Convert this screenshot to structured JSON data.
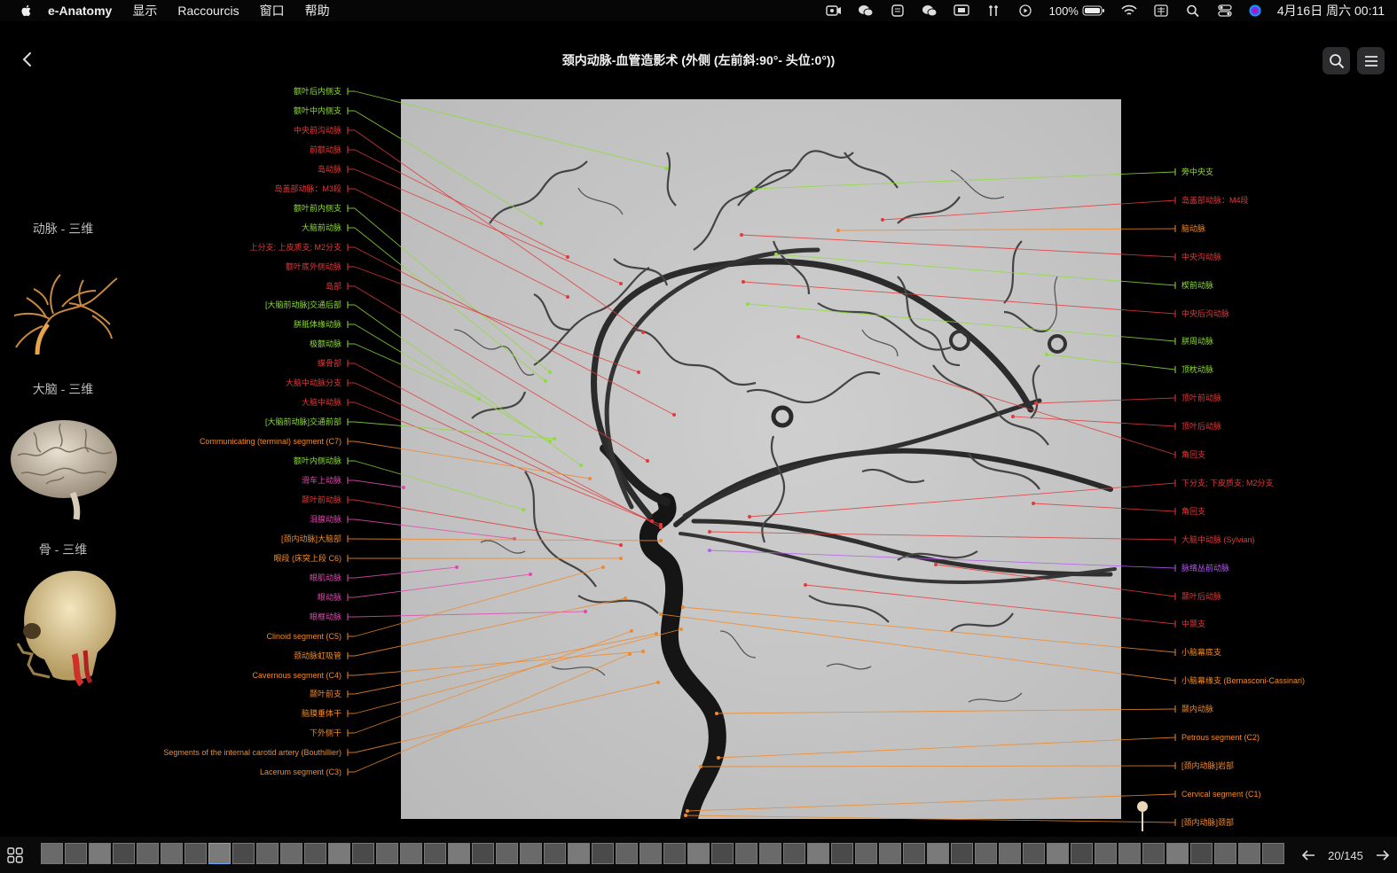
{
  "menubar": {
    "app_name": "e-Anatomy",
    "items": [
      "显示",
      "Raccourcis",
      "窗口",
      "帮助"
    ],
    "battery": "100%",
    "datetime": "4月16日 周六 00:11"
  },
  "header": {
    "title": "颈内动脉-血管造影术 (外侧 (左前斜:90°- 头位:0°))"
  },
  "sidebar": {
    "items": [
      {
        "label": "动脉 - 三维"
      },
      {
        "label": "大脑 - 三维"
      },
      {
        "label": "骨 - 三维"
      }
    ]
  },
  "labels_left": [
    {
      "text": "额叶后内侧支",
      "color": "#8fdc3a"
    },
    {
      "text": "额叶中内侧支",
      "color": "#8fdc3a"
    },
    {
      "text": "中央前沟动脉",
      "color": "#e23a3a"
    },
    {
      "text": "前额动脉",
      "color": "#e23a3a"
    },
    {
      "text": "岛动脉",
      "color": "#e23a3a"
    },
    {
      "text": "岛盖部动脉：M3段",
      "color": "#e23a3a"
    },
    {
      "text": "额叶前内侧支",
      "color": "#8fdc3a"
    },
    {
      "text": "大脑前动脉",
      "color": "#8fdc3a"
    },
    {
      "text": "上分支; 上皮质支; M2分支",
      "color": "#e23a3a"
    },
    {
      "text": "额叶底外侧动脉",
      "color": "#e23a3a"
    },
    {
      "text": "岛部",
      "color": "#e23a3a"
    },
    {
      "text": "[大脑前动脉]交通后部",
      "color": "#8fdc3a"
    },
    {
      "text": "胼胝体缘动脉",
      "color": "#8fdc3a"
    },
    {
      "text": "极额动脉",
      "color": "#8fdc3a"
    },
    {
      "text": "蝶骨部",
      "color": "#e23a3a"
    },
    {
      "text": "大脑中动脉分支",
      "color": "#e23a3a"
    },
    {
      "text": "大脑中动脉",
      "color": "#e23a3a"
    },
    {
      "text": "[大脑前动脉]交通前部",
      "color": "#8fdc3a"
    },
    {
      "text": "Communicating (terminal) segment (C7)",
      "color": "#f08a2a"
    },
    {
      "text": "额叶内侧动脉",
      "color": "#8fdc3a"
    },
    {
      "text": "滑车上动脉",
      "color": "#e04ab0"
    },
    {
      "text": "颞叶前动脉",
      "color": "#e23a3a"
    },
    {
      "text": "泪腺动脉",
      "color": "#e04ab0"
    },
    {
      "text": "[颈内动脉]大脑部",
      "color": "#f08a2a"
    },
    {
      "text": "眼段 (床突上段 C6)",
      "color": "#f08a2a"
    },
    {
      "text": "眼肌动脉",
      "color": "#e04ab0"
    },
    {
      "text": "眼动脉",
      "color": "#e04ab0"
    },
    {
      "text": "眼框动脉",
      "color": "#e04ab0"
    },
    {
      "text": "Clinoid segment (C5)",
      "color": "#f08a2a"
    },
    {
      "text": "颈动脉虹吸管",
      "color": "#f08a2a"
    },
    {
      "text": "Cavernous segment (C4)",
      "color": "#f08a2a"
    },
    {
      "text": "颞叶前支",
      "color": "#f08a2a"
    },
    {
      "text": "脑膜垂体干",
      "color": "#f08a2a"
    },
    {
      "text": "下外侧干",
      "color": "#f08a2a"
    },
    {
      "text": "Segments of the internal carotid artery (Bouthillier)",
      "color": "#f08a2a"
    },
    {
      "text": "Lacerum segment (C3)",
      "color": "#f08a2a"
    }
  ],
  "labels_right": [
    {
      "text": "旁中央支",
      "color": "#8fdc3a"
    },
    {
      "text": "岛盖部动脉：M4段",
      "color": "#e23a3a"
    },
    {
      "text": "脑动脉",
      "color": "#f08a2a"
    },
    {
      "text": "中央沟动脉",
      "color": "#e23a3a"
    },
    {
      "text": "楔前动脉",
      "color": "#8fdc3a"
    },
    {
      "text": "中央后沟动脉",
      "color": "#e23a3a"
    },
    {
      "text": "胼周动脉",
      "color": "#8fdc3a"
    },
    {
      "text": "顶枕动脉",
      "color": "#8fdc3a"
    },
    {
      "text": "顶叶前动脉",
      "color": "#e23a3a"
    },
    {
      "text": "顶叶后动脉",
      "color": "#e23a3a"
    },
    {
      "text": "角回支",
      "color": "#e23a3a"
    },
    {
      "text": "下分支; 下皮质支; M2分支",
      "color": "#e23a3a"
    },
    {
      "text": "角回支",
      "color": "#e23a3a"
    },
    {
      "text": "大脑中动脉 (Sylvian)",
      "color": "#e23a3a"
    },
    {
      "text": "脉络丛前动脉",
      "color": "#b35cf0"
    },
    {
      "text": "颞叶后动脉",
      "color": "#e23a3a"
    },
    {
      "text": "中颞支",
      "color": "#e23a3a"
    },
    {
      "text": "小脑幕底支",
      "color": "#f08a2a"
    },
    {
      "text": "小脑幕缘支 (Bernasconi-Cassinari)",
      "color": "#f08a2a"
    },
    {
      "text": "颞内动脉",
      "color": "#f08a2a"
    },
    {
      "text": "Petrous segment (C2)",
      "color": "#f08a2a"
    },
    {
      "text": "[颈内动脉]岩部",
      "color": "#f08a2a"
    },
    {
      "text": "Cervical segment (C1)",
      "color": "#f08a2a"
    },
    {
      "text": "[颈内动脉]颈部",
      "color": "#f08a2a"
    }
  ],
  "pager": {
    "text": "20/145"
  },
  "icons": {
    "back": "chevron-left-icon",
    "search": "search-icon",
    "menu": "hamburger-menu-icon",
    "grid": "grid-icon",
    "prev": "arrow-left-icon",
    "next": "arrow-right-icon"
  }
}
